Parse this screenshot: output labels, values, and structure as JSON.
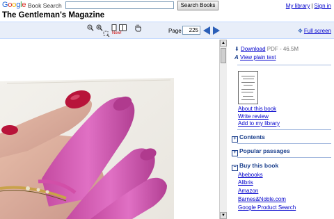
{
  "header": {
    "logo": "Google",
    "product": "Book Search",
    "search_placeholder": "",
    "search_button": "Search Books",
    "my_library": "My library",
    "separator": "|",
    "sign_in": "Sign in"
  },
  "book": {
    "title": "The Gentleman's Magazine"
  },
  "toolbar": {
    "new_badge": "New!",
    "page_label": "Page",
    "page_number": "225",
    "full_screen": "Full screen",
    "icons": [
      "zoom-out-icon",
      "zoom-in-icon",
      "clip-icon",
      "single-page-icon",
      "two-page-icon",
      "hand-pan-icon",
      "prev-page-icon",
      "next-page-icon",
      "fullscreen-icon"
    ]
  },
  "sidebar": {
    "download": "Download",
    "download_meta": "PDF - 46.5M",
    "view_plain_text": "View plain text",
    "about": "About this book",
    "write_review": "Write review",
    "add_library": "Add to my library",
    "sections": [
      "Contents",
      "Popular passages",
      "Buy this book"
    ],
    "stores": [
      "Abebooks",
      "Alibris",
      "Amazon",
      "Barnes&Noble.com",
      "Google Product Search"
    ]
  },
  "colors": {
    "toolbar_bg": "#e8eef9",
    "link": "#0000cc",
    "nav_arrow": "#2b5fb8",
    "nail_polish": "#c0143c",
    "glove_pink": "#d94fb0"
  }
}
